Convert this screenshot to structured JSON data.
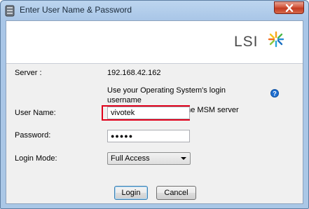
{
  "window": {
    "title": "Enter User Name & Password"
  },
  "header": {
    "logo_text": "LSI"
  },
  "form": {
    "server_label": "Server :",
    "server_value": "192.168.42.162",
    "hint_line1": "Use your Operating System's login username",
    "hint_line2": "and password to login the MSM server",
    "username_label": "User Name:",
    "username_value": "vivotek",
    "password_label": "Password:",
    "password_value": "●●●●●",
    "login_mode_label": "Login Mode:",
    "login_mode_value": "Full Access"
  },
  "buttons": {
    "login": "Login",
    "cancel": "Cancel"
  },
  "colors": {
    "highlight": "#e0001b",
    "logo_text": "#4a4a4a",
    "help": "#1f6fd1"
  }
}
